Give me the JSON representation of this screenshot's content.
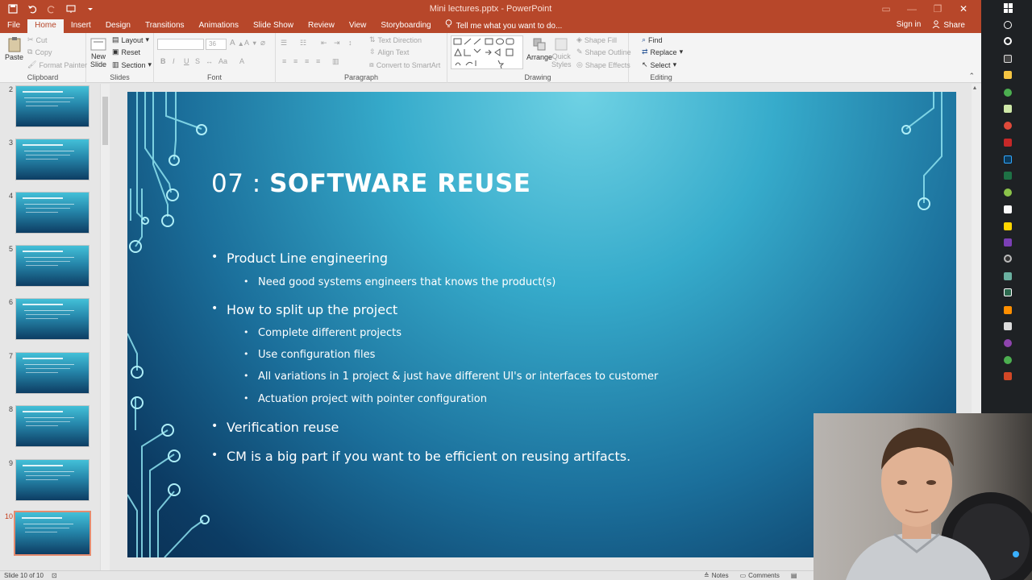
{
  "titlebar": {
    "title": "Mini lectures.pptx - PowerPoint",
    "qat_icons": [
      "save-icon",
      "undo-icon",
      "redo-icon",
      "present-icon",
      "customize-icon"
    ],
    "window_controls": [
      "ribbon-display-icon",
      "minimize-icon",
      "restore-icon",
      "close-icon"
    ]
  },
  "tabs": {
    "items": [
      "File",
      "Home",
      "Insert",
      "Design",
      "Transitions",
      "Animations",
      "Slide Show",
      "Review",
      "View",
      "Storyboarding"
    ],
    "active": "Home",
    "tell_me": "Tell me what you want to do...",
    "sign_in": "Sign in",
    "share": "Share"
  },
  "ribbon": {
    "clipboard": {
      "label": "Clipboard",
      "paste": "Paste",
      "cut": "Cut",
      "copy": "Copy",
      "format_painter": "Format Painter"
    },
    "slides": {
      "label": "Slides",
      "new_slide_1": "New",
      "new_slide_2": "Slide",
      "layout": "Layout",
      "reset": "Reset",
      "section": "Section"
    },
    "font": {
      "label": "Font",
      "font_size": "36"
    },
    "paragraph": {
      "label": "Paragraph",
      "text_direction": "Text Direction",
      "align_text": "Align Text",
      "convert_smartart": "Convert to SmartArt"
    },
    "drawing": {
      "label": "Drawing",
      "arrange": "Arrange",
      "quick_styles_1": "Quick",
      "quick_styles_2": "Styles",
      "shape_fill": "Shape Fill",
      "shape_outline": "Shape Outline",
      "shape_effects": "Shape Effects"
    },
    "editing": {
      "label": "Editing",
      "find": "Find",
      "replace": "Replace",
      "select": "Select"
    }
  },
  "thumbnails": [
    {
      "num": "2"
    },
    {
      "num": "3"
    },
    {
      "num": "4"
    },
    {
      "num": "5"
    },
    {
      "num": "6"
    },
    {
      "num": "7"
    },
    {
      "num": "8"
    },
    {
      "num": "9"
    },
    {
      "num": "10",
      "active": true
    }
  ],
  "slide": {
    "title_num": "07 : ",
    "title_head": "SOFTWARE REUSE",
    "bullets": [
      {
        "level": 1,
        "text": "Product Line engineering"
      },
      {
        "level": 2,
        "text": "Need good systems engineers that knows the product(s)"
      },
      {
        "level": 1,
        "text": "How to split up the project"
      },
      {
        "level": 2,
        "text": "Complete different projects"
      },
      {
        "level": 2,
        "text": "Use configuration files"
      },
      {
        "level": 2,
        "text": "All variations in 1 project & just have different UI's or interfaces to customer"
      },
      {
        "level": 2,
        "text": "Actuation project with pointer configuration"
      },
      {
        "level": 1,
        "text": "Verification reuse"
      },
      {
        "level": 1,
        "text": "CM is a big part if you want to be efficient on reusing artifacts."
      }
    ]
  },
  "statusbar": {
    "slide_info": "Slide 10 of 10",
    "notes": "Notes",
    "comments": "Comments"
  },
  "colors": {
    "accent": "#b7472a",
    "slide_top": "#6fd2e4",
    "slide_bottom": "#0a3155"
  }
}
